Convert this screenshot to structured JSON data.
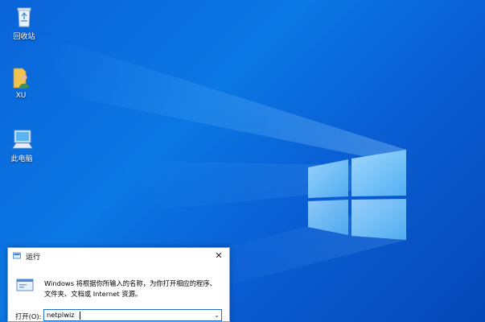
{
  "desktop": {
    "icons": [
      {
        "label": "回收站"
      },
      {
        "label": "XU"
      },
      {
        "label": "此电脑"
      }
    ]
  },
  "run_dialog": {
    "title": "运行",
    "close_symbol": "✕",
    "description_line1": "Windows 将根据你所输入的名称，为你打开相应的程序、",
    "description_line2": "文件夹、文档或 Internet 资源。",
    "open_label": "打开(O):",
    "open_value": "netplwiz",
    "dropdown_symbol": "⌄"
  },
  "colors": {
    "desktop_blue": "#0a63d8",
    "logo_light": "#8fd0ff",
    "input_border": "#1e6fd0"
  }
}
